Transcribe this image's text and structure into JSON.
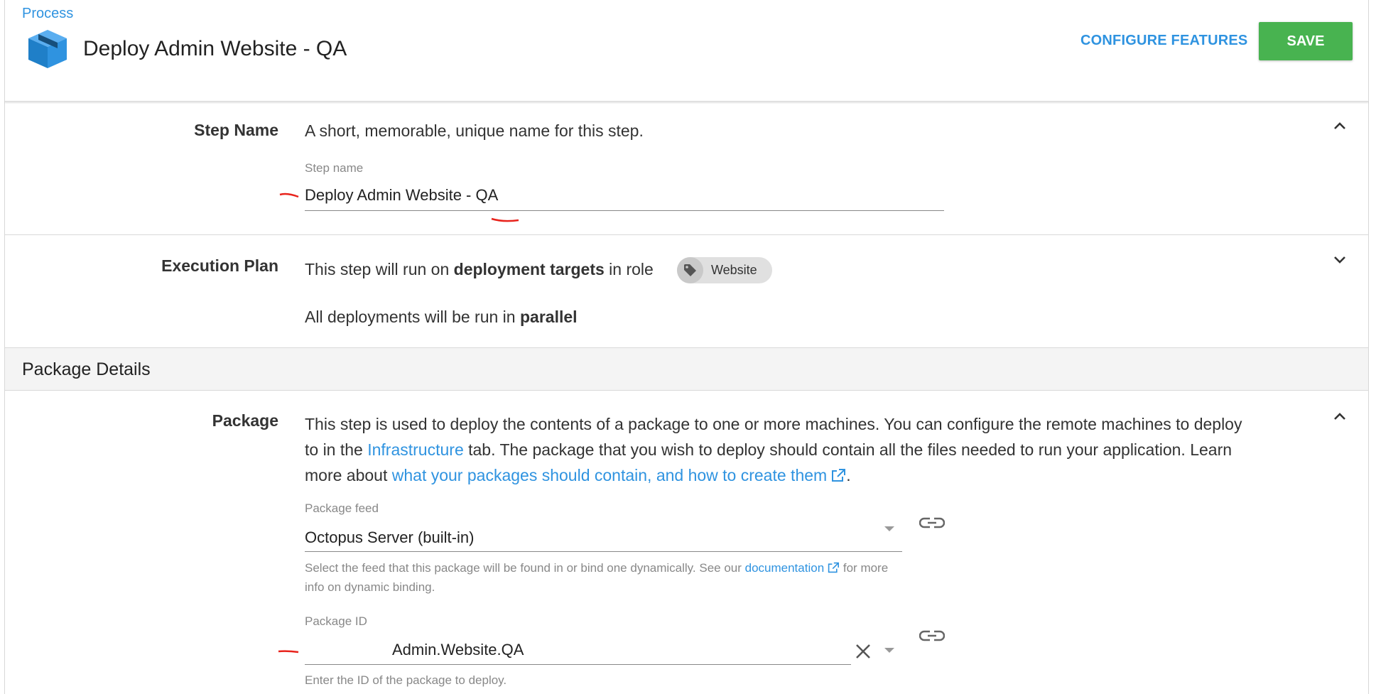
{
  "header": {
    "breadcrumb": "Process",
    "title": "Deploy Admin Website - QA",
    "configure_label": "CONFIGURE FEATURES",
    "save_label": "SAVE"
  },
  "step_name": {
    "label": "Step Name",
    "description": "A short, memorable, unique name for this step.",
    "field_label": "Step name",
    "field_value": "Deploy Admin Website - QA"
  },
  "execution_plan": {
    "label": "Execution Plan",
    "line1_prefix": "This step will run on ",
    "line1_bold": "deployment targets",
    "line1_suffix": " in role",
    "role_tag": "Website",
    "line2_prefix": "All deployments will be run in ",
    "line2_bold": "parallel"
  },
  "package_details": {
    "heading": "Package Details"
  },
  "package": {
    "label": "Package",
    "desc_1": "This step is used to deploy the contents of a package to one or more machines. You can configure the remote machines to deploy",
    "desc_2_prefix": "to in the ",
    "desc_2_link": "Infrastructure",
    "desc_2_suffix": " tab. The package that you wish to deploy should contain all the files needed to run your application. Learn",
    "desc_3_prefix": "more about ",
    "desc_3_link": "what your packages should contain, and how to create them",
    "desc_3_suffix": ".",
    "feed_label": "Package feed",
    "feed_value": "Octopus Server (built-in)",
    "feed_hint_1_prefix": "Select the feed that this package will be found in or bind one dynamically. See our ",
    "feed_hint_1_link": "documentation",
    "feed_hint_1_suffix": " for more",
    "feed_hint_2": "info on dynamic binding.",
    "id_label": "Package ID",
    "id_value": "Admin.Website.QA",
    "id_hint": "Enter the ID of the package to deploy."
  },
  "colors": {
    "accent": "#2f93e0",
    "save": "#48b350",
    "annotation": "#e8231c"
  },
  "icons": [
    "package-box-icon",
    "chevron-up-icon",
    "chevron-down-icon",
    "tag-icon",
    "external-link-icon",
    "link-icon",
    "clear-icon",
    "dropdown-arrow-icon"
  ]
}
